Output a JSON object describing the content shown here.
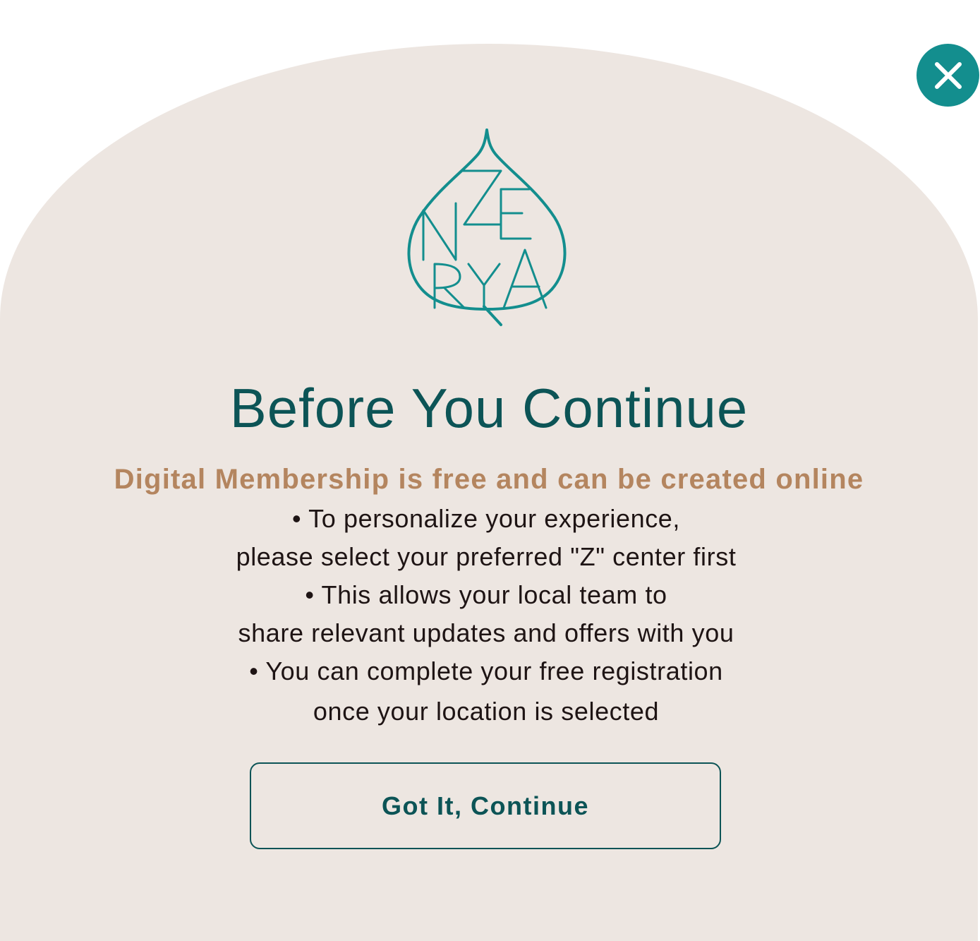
{
  "modal": {
    "close_icon": "close-icon",
    "logo_text": "ZENRYA",
    "title": "Before You Continue",
    "subtitle": "Digital Membership is free and can be created online",
    "lines": [
      "• To personalize your experience,",
      "please select your preferred \"Z\" center first",
      "• This allows your local team to",
      "share relevant updates and offers with you",
      "• You can complete your free registration",
      "once your location is selected"
    ],
    "button_label": "Got It, Continue"
  },
  "colors": {
    "panel_bg": "#ede6e1",
    "accent_teal": "#138e8e",
    "title_teal": "#0c5456",
    "subtitle_tan": "#b4855f",
    "body_text": "#1e1414"
  }
}
